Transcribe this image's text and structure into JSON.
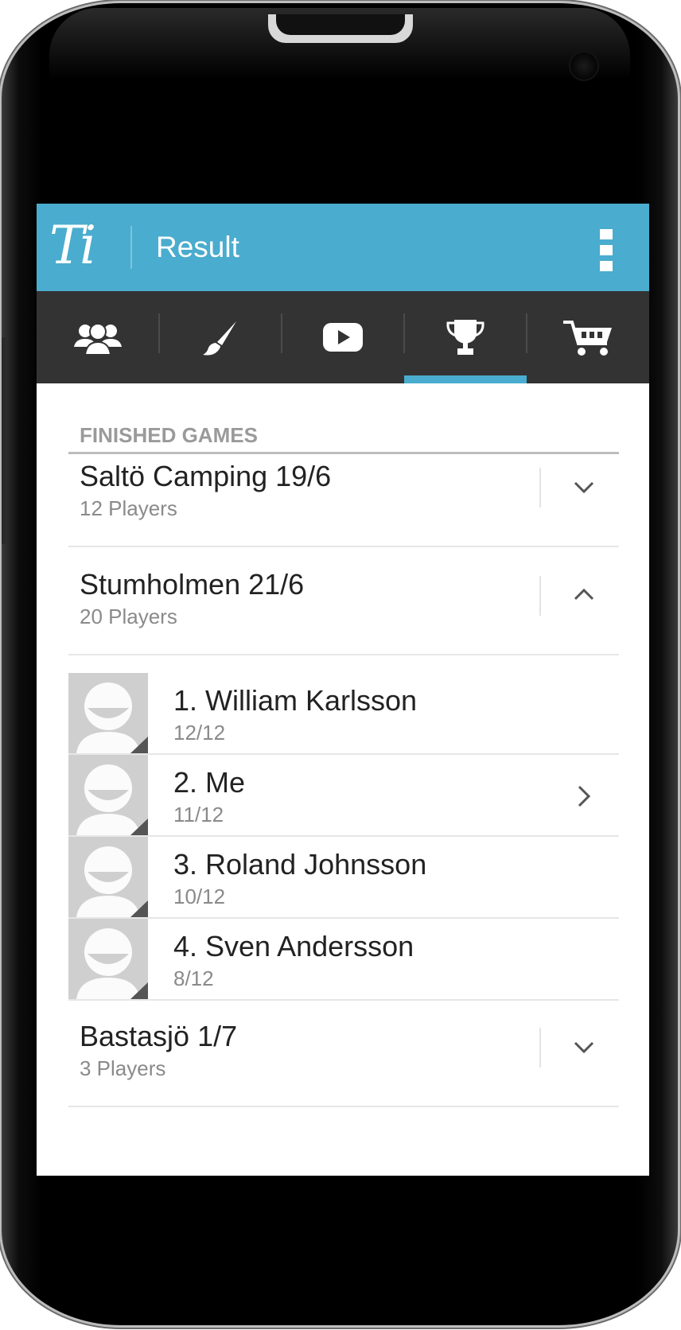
{
  "app": {
    "logo_text": "Ti",
    "title": "Result"
  },
  "tabs": [
    {
      "icon": "group-icon"
    },
    {
      "icon": "brush-icon"
    },
    {
      "icon": "play-video-icon"
    },
    {
      "icon": "trophy-icon",
      "selected": true
    },
    {
      "icon": "shopping-cart-icon"
    }
  ],
  "section": {
    "header": "FINISHED GAMES"
  },
  "games": [
    {
      "title": "Saltö Camping 19/6",
      "players": "12 Players",
      "expanded": false
    },
    {
      "title": "Stumholmen 21/6",
      "players": "20 Players",
      "expanded": true
    },
    {
      "title": "Bastasjö 1/7",
      "players": "3 Players",
      "expanded": false
    }
  ],
  "results": [
    {
      "name": "1. William Karlsson",
      "score": "12/12"
    },
    {
      "name": "2. Me",
      "score": "11/12"
    },
    {
      "name": "3. Roland Johnsson",
      "score": "10/12"
    },
    {
      "name": "4. Sven Andersson",
      "score": "8/12"
    }
  ],
  "colors": {
    "accent": "#4aacce",
    "tab_bar": "#333333",
    "phone_frame": "#000000"
  }
}
